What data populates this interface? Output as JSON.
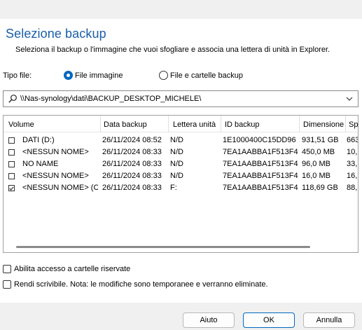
{
  "dialog": {
    "title": "Selezione backup",
    "subtitle": "Seleziona il backup o l'immagine che vuoi sfogliare e associa una lettera di unità in Explorer."
  },
  "file_type": {
    "label": "Tipo file:",
    "options": [
      {
        "label": "File immagine",
        "selected": true
      },
      {
        "label": "File e cartelle backup",
        "selected": false
      }
    ]
  },
  "path": {
    "value": "\\\\Nas-synology\\dati\\BACKUP_DESKTOP_MICHELE\\"
  },
  "table": {
    "columns": [
      "Volume",
      "Data backup",
      "Lettera unità",
      "ID backup",
      "Dimensione",
      "Sp"
    ],
    "rows": [
      {
        "checked": false,
        "cells": [
          "DATI (D:)",
          "26/11/2024 08:52",
          "N/D",
          "1E1000400C15DD96",
          "931,51 GB",
          "663"
        ]
      },
      {
        "checked": false,
        "cells": [
          "<NESSUN NOME>",
          "26/11/2024 08:33",
          "N/D",
          "7EA1AABBA1F513F4",
          "450,0 MB",
          "10,"
        ]
      },
      {
        "checked": false,
        "cells": [
          "NO NAME",
          "26/11/2024 08:33",
          "N/D",
          "7EA1AABBA1F513F4",
          "96,0 MB",
          "33,"
        ]
      },
      {
        "checked": false,
        "cells": [
          "<NESSUN NOME>",
          "26/11/2024 08:33",
          "N/D",
          "7EA1AABBA1F513F4",
          "16,0 MB",
          "16,"
        ]
      },
      {
        "checked": true,
        "cells": [
          "<NESSUN NOME> (C:)",
          "26/11/2024 08:33",
          "F:",
          "7EA1AABBA1F513F4",
          "118,69 GB",
          "88,"
        ]
      }
    ]
  },
  "options": {
    "hidden_folders": "Abilita accesso a cartelle riservate",
    "writable": "Rendi scrivibile. Nota: le modifiche sono temporanee e verranno eliminate."
  },
  "buttons": {
    "help": "Aiuto",
    "ok": "OK",
    "cancel": "Annulla"
  },
  "colors": {
    "title": "#1a5fa8",
    "accent": "#0067c0"
  }
}
